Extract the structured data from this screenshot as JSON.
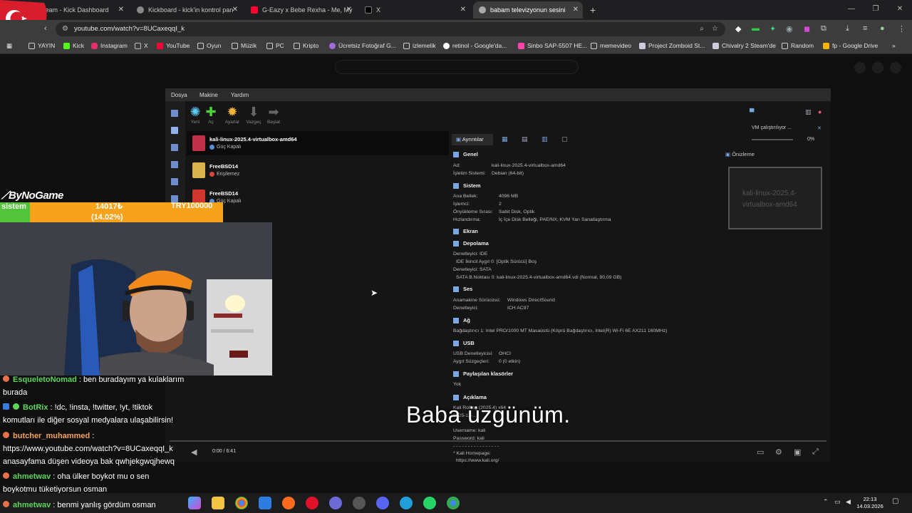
{
  "browser": {
    "tabs": [
      {
        "label": "Stream - Kick Dashboard"
      },
      {
        "label": "Kickboard - kick'in kontrol pan"
      },
      {
        "label": "G-Eazy x Bebe Rexha - Me, My"
      },
      {
        "label": "X"
      },
      {
        "label": "babam televizyonun sesini"
      }
    ],
    "new_tab": "+",
    "url": "youtube.com/watch?v=8UCaxeqqI_k",
    "bookmarks": [
      "YAYIN",
      "Kick",
      "Instagram",
      "X",
      "YouTube",
      "Oyun",
      "Müzik",
      "PC",
      "Kripto",
      "Ücretsiz Fotoğraf G...",
      "izlemelik",
      "retinol - Google'da...",
      "Sinbo SAP-5507 HE...",
      "memevideo",
      "Project Zomboid St...",
      "Chivalry 2 Steam'de",
      "Random",
      "fp - Google Drive"
    ]
  },
  "virtualbox": {
    "menu": [
      "Dosya",
      "Makine",
      "Yardım"
    ],
    "tools": [
      "Yeni",
      "Aç",
      "Ayarlar",
      "Vazgeç",
      "Başlat"
    ],
    "vms": [
      {
        "name": "kali-linux-2025.4-virtualbox-amd64",
        "state": "Güç Kapalı"
      },
      {
        "name": "FreeBSD14",
        "state": "Erişilemez"
      },
      {
        "name": "FreeBSD14",
        "state": "Güç Kapalı"
      }
    ],
    "details_tab": "Ayrıntılar",
    "preview_label": "Önizleme",
    "preview_text": "kali-linux-2025.4-virtualbox-amd64",
    "vm_running": "VM çalıştırılıyor ...",
    "vm_running_pct": "0%",
    "sections": {
      "general": "Genel",
      "system": "Sistem",
      "display": "Ekran",
      "storage": "Depolama",
      "audio": "Ses",
      "network": "Ağ",
      "usb": "USB",
      "shared": "Paylaşılan klasörler",
      "description": "Açıklama"
    },
    "general_rows": [
      {
        "k": "Ad:",
        "v": "kali-linux-2025.4-virtualbox-amd64"
      },
      {
        "k": "İşletim Sistemi:",
        "v": "Debian (64-bit)"
      }
    ],
    "system_rows": [
      {
        "k": "Ana Bellek:",
        "v": "4096 MB"
      },
      {
        "k": "İşlemci:",
        "v": "2"
      },
      {
        "k": "Önyükleme Sırası:",
        "v": "Sabit Disk, Optik"
      },
      {
        "k": "Hızlandırma:",
        "v": "İç İçe Disk Belleği, PAE/NX, KVM Yarı Sanallaştırma"
      }
    ],
    "storage_rows": [
      "Denetleyici: IDE",
      "IDE İkincil Aygıt 0:    [Optik Sürücü] Boş",
      "Denetleyici: SATA",
      "SATA B.Noktası 0:    kali-linux-2025.4-virtualbox-amd64.vdi (Normal, 80,09 GB)"
    ],
    "audio_rows": [
      {
        "k": "Anamakine Sürücüsü:",
        "v": "Windows DirectSound"
      },
      {
        "k": "Denetleyici:",
        "v": "ICH AC97"
      }
    ],
    "network_row": "Bağdaştırıcı 1:    Intel PRO/1000 MT Masaüstü (Köprü Bağdaştırıcı, Intel(R) Wi-Fi 6E AX211 160MHz)",
    "usb_rows": [
      {
        "k": "USB Denetleyicisi:",
        "v": "OHCI"
      },
      {
        "k": "Aygıt Süzgeçleri:",
        "v": "0 (0 etkin)"
      }
    ],
    "shared_value": "Yok",
    "description_rows": [
      "Kali Rolling (2025.4) x64",
      "2025-12-...",
      "Username: kali",
      "Password: kali",
      "- - - - - - - - - - - - - - - -",
      "* Kali Homepage:",
      "https://www.kali.org/"
    ]
  },
  "player": {
    "subtitle": "Baba üzgünüm.",
    "time": "0:00 / 6:41"
  },
  "stream": {
    "brand": "ByNoGame",
    "goal_label": "sistem",
    "goal_current": "14017₺",
    "goal_percent": "(14.02%)",
    "goal_target": "TRY100000"
  },
  "chat": [
    {
      "user": "EsqueletoNomad",
      "text": ": ben buradayım ya kulaklarım",
      "cont": "burada",
      "color": "#5bd65b"
    },
    {
      "user": "BotRix",
      "text": ": !dc, !insta, !twitter, !yt, !tiktok",
      "cont": "komutları ile diğer sosyal medyalara ulaşabilirsin!",
      "color": "#5bd65b"
    },
    {
      "user": "butcher_muhammed",
      "text": ":",
      "cont": "https://www.youtube.com/watch?v=8UCaxeqqI_k",
      "cont2": "anasayfama düşen videoya bak qwhjekgwqjhewq",
      "color": "#f5a35b"
    },
    {
      "user": "ahmetwav",
      "text": ": oha ülker boykot mu o sen",
      "cont": "boykotmu tüketiyorsun osman",
      "color": "#5bd65b"
    },
    {
      "user": "ahmetwav",
      "text": ": benmi yanlış gördüm osman",
      "color": "#5bd65b"
    }
  ],
  "taskbar": {
    "time": "22:13",
    "date": "14.03.2026"
  },
  "colors": {
    "goal_orange": "#f7a21b",
    "goal_green": "#53c33a",
    "accent_blue": "#7aa7e0"
  }
}
